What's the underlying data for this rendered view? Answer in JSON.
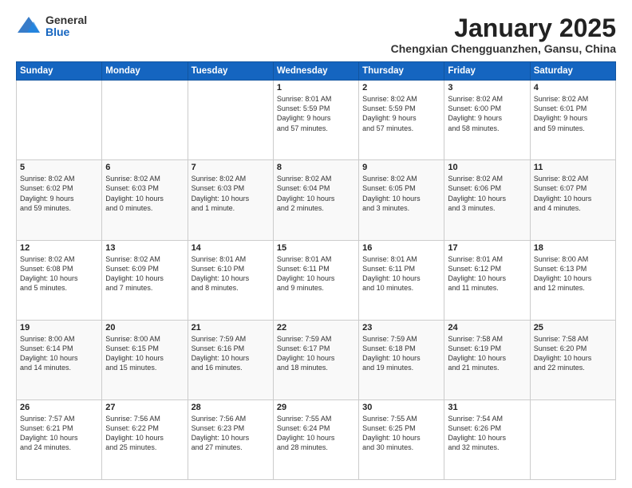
{
  "logo": {
    "general": "General",
    "blue": "Blue"
  },
  "title": "January 2025",
  "subtitle": "Chengxian Chengguanzhen, Gansu, China",
  "days_header": [
    "Sunday",
    "Monday",
    "Tuesday",
    "Wednesday",
    "Thursday",
    "Friday",
    "Saturday"
  ],
  "weeks": [
    [
      {
        "day": "",
        "info": ""
      },
      {
        "day": "",
        "info": ""
      },
      {
        "day": "",
        "info": ""
      },
      {
        "day": "1",
        "info": "Sunrise: 8:01 AM\nSunset: 5:59 PM\nDaylight: 9 hours\nand 57 minutes."
      },
      {
        "day": "2",
        "info": "Sunrise: 8:02 AM\nSunset: 5:59 PM\nDaylight: 9 hours\nand 57 minutes."
      },
      {
        "day": "3",
        "info": "Sunrise: 8:02 AM\nSunset: 6:00 PM\nDaylight: 9 hours\nand 58 minutes."
      },
      {
        "day": "4",
        "info": "Sunrise: 8:02 AM\nSunset: 6:01 PM\nDaylight: 9 hours\nand 59 minutes."
      }
    ],
    [
      {
        "day": "5",
        "info": "Sunrise: 8:02 AM\nSunset: 6:02 PM\nDaylight: 9 hours\nand 59 minutes."
      },
      {
        "day": "6",
        "info": "Sunrise: 8:02 AM\nSunset: 6:03 PM\nDaylight: 10 hours\nand 0 minutes."
      },
      {
        "day": "7",
        "info": "Sunrise: 8:02 AM\nSunset: 6:03 PM\nDaylight: 10 hours\nand 1 minute."
      },
      {
        "day": "8",
        "info": "Sunrise: 8:02 AM\nSunset: 6:04 PM\nDaylight: 10 hours\nand 2 minutes."
      },
      {
        "day": "9",
        "info": "Sunrise: 8:02 AM\nSunset: 6:05 PM\nDaylight: 10 hours\nand 3 minutes."
      },
      {
        "day": "10",
        "info": "Sunrise: 8:02 AM\nSunset: 6:06 PM\nDaylight: 10 hours\nand 3 minutes."
      },
      {
        "day": "11",
        "info": "Sunrise: 8:02 AM\nSunset: 6:07 PM\nDaylight: 10 hours\nand 4 minutes."
      }
    ],
    [
      {
        "day": "12",
        "info": "Sunrise: 8:02 AM\nSunset: 6:08 PM\nDaylight: 10 hours\nand 5 minutes."
      },
      {
        "day": "13",
        "info": "Sunrise: 8:02 AM\nSunset: 6:09 PM\nDaylight: 10 hours\nand 7 minutes."
      },
      {
        "day": "14",
        "info": "Sunrise: 8:01 AM\nSunset: 6:10 PM\nDaylight: 10 hours\nand 8 minutes."
      },
      {
        "day": "15",
        "info": "Sunrise: 8:01 AM\nSunset: 6:11 PM\nDaylight: 10 hours\nand 9 minutes."
      },
      {
        "day": "16",
        "info": "Sunrise: 8:01 AM\nSunset: 6:11 PM\nDaylight: 10 hours\nand 10 minutes."
      },
      {
        "day": "17",
        "info": "Sunrise: 8:01 AM\nSunset: 6:12 PM\nDaylight: 10 hours\nand 11 minutes."
      },
      {
        "day": "18",
        "info": "Sunrise: 8:00 AM\nSunset: 6:13 PM\nDaylight: 10 hours\nand 12 minutes."
      }
    ],
    [
      {
        "day": "19",
        "info": "Sunrise: 8:00 AM\nSunset: 6:14 PM\nDaylight: 10 hours\nand 14 minutes."
      },
      {
        "day": "20",
        "info": "Sunrise: 8:00 AM\nSunset: 6:15 PM\nDaylight: 10 hours\nand 15 minutes."
      },
      {
        "day": "21",
        "info": "Sunrise: 7:59 AM\nSunset: 6:16 PM\nDaylight: 10 hours\nand 16 minutes."
      },
      {
        "day": "22",
        "info": "Sunrise: 7:59 AM\nSunset: 6:17 PM\nDaylight: 10 hours\nand 18 minutes."
      },
      {
        "day": "23",
        "info": "Sunrise: 7:59 AM\nSunset: 6:18 PM\nDaylight: 10 hours\nand 19 minutes."
      },
      {
        "day": "24",
        "info": "Sunrise: 7:58 AM\nSunset: 6:19 PM\nDaylight: 10 hours\nand 21 minutes."
      },
      {
        "day": "25",
        "info": "Sunrise: 7:58 AM\nSunset: 6:20 PM\nDaylight: 10 hours\nand 22 minutes."
      }
    ],
    [
      {
        "day": "26",
        "info": "Sunrise: 7:57 AM\nSunset: 6:21 PM\nDaylight: 10 hours\nand 24 minutes."
      },
      {
        "day": "27",
        "info": "Sunrise: 7:56 AM\nSunset: 6:22 PM\nDaylight: 10 hours\nand 25 minutes."
      },
      {
        "day": "28",
        "info": "Sunrise: 7:56 AM\nSunset: 6:23 PM\nDaylight: 10 hours\nand 27 minutes."
      },
      {
        "day": "29",
        "info": "Sunrise: 7:55 AM\nSunset: 6:24 PM\nDaylight: 10 hours\nand 28 minutes."
      },
      {
        "day": "30",
        "info": "Sunrise: 7:55 AM\nSunset: 6:25 PM\nDaylight: 10 hours\nand 30 minutes."
      },
      {
        "day": "31",
        "info": "Sunrise: 7:54 AM\nSunset: 6:26 PM\nDaylight: 10 hours\nand 32 minutes."
      },
      {
        "day": "",
        "info": ""
      }
    ]
  ]
}
